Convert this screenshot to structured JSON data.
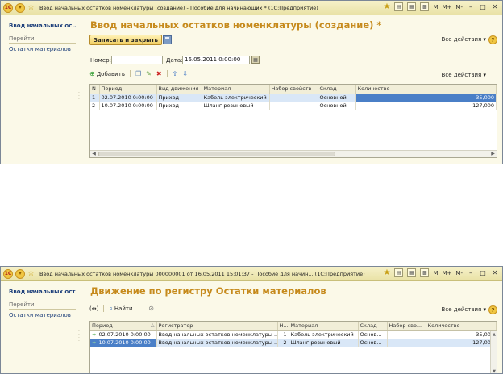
{
  "window1": {
    "title": "Ввод начальных остатков номенклатуры (создание) - Пособие для начинающих * (1С:Предприятие)",
    "titlebar_buttons": [
      "M",
      "M+",
      "M-"
    ],
    "sidebar": {
      "title": "Ввод начальных ос...",
      "section": "Перейти",
      "items": [
        "Остатки материалов"
      ]
    },
    "form": {
      "title": "Ввод начальных остатков номенклатуры (создание) *",
      "save_close_label": "Записать и закрыть",
      "all_actions_label": "Все действия",
      "help_label": "?",
      "number_label": "Номер:",
      "number_value": "",
      "date_label": "Дата:",
      "date_value": "16.05.2011  0:00:00",
      "toolbar_add_label": "Добавить",
      "table_all_actions_label": "Все действия"
    },
    "table": {
      "columns": [
        "N",
        "Период",
        "Вид движения",
        "Материал",
        "Набор свойств",
        "Склад",
        "Количество"
      ],
      "rows": [
        [
          "1",
          "02.07.2010 0:00:00",
          "Приход",
          "Кабель электрический",
          "",
          "Основной",
          "35,000"
        ],
        [
          "2",
          "10.07.2010 0:00:00",
          "Приход",
          "Шланг резиновый",
          "",
          "Основной",
          "127,000"
        ]
      ]
    }
  },
  "window2": {
    "title": "Ввод начальных остатков номенклатуры 000000001 от 16.05.2011 15:01:37 - Пособие для начин...  (1С:Предприятие)",
    "titlebar_buttons": [
      "M",
      "M+",
      "M-"
    ],
    "sidebar": {
      "title": "Ввод начальных ост...",
      "section": "Перейти",
      "items": [
        "Остатки материалов"
      ]
    },
    "form": {
      "title": "Движение по регистру Остатки материалов",
      "find_label": "Найти...",
      "all_actions_label": "Все действия",
      "help_label": "?",
      "back_label": "(↔)"
    },
    "table": {
      "columns": [
        "Период",
        "Регистратор",
        "Н...",
        "Материал",
        "Склад",
        "Набор сво...",
        "Количество"
      ],
      "rows": [
        [
          "02.07.2010 0:00:00",
          "Ввод начальных остатков номенклатуры ...",
          "1",
          "Кабель электрический",
          "Основ...",
          "",
          "35,000"
        ],
        [
          "10.07.2010 0:00:00",
          "Ввод начальных остатков номенклатуры ...",
          "2",
          "Шланг резиновый",
          "Основ...",
          "",
          "127,000"
        ]
      ]
    }
  }
}
